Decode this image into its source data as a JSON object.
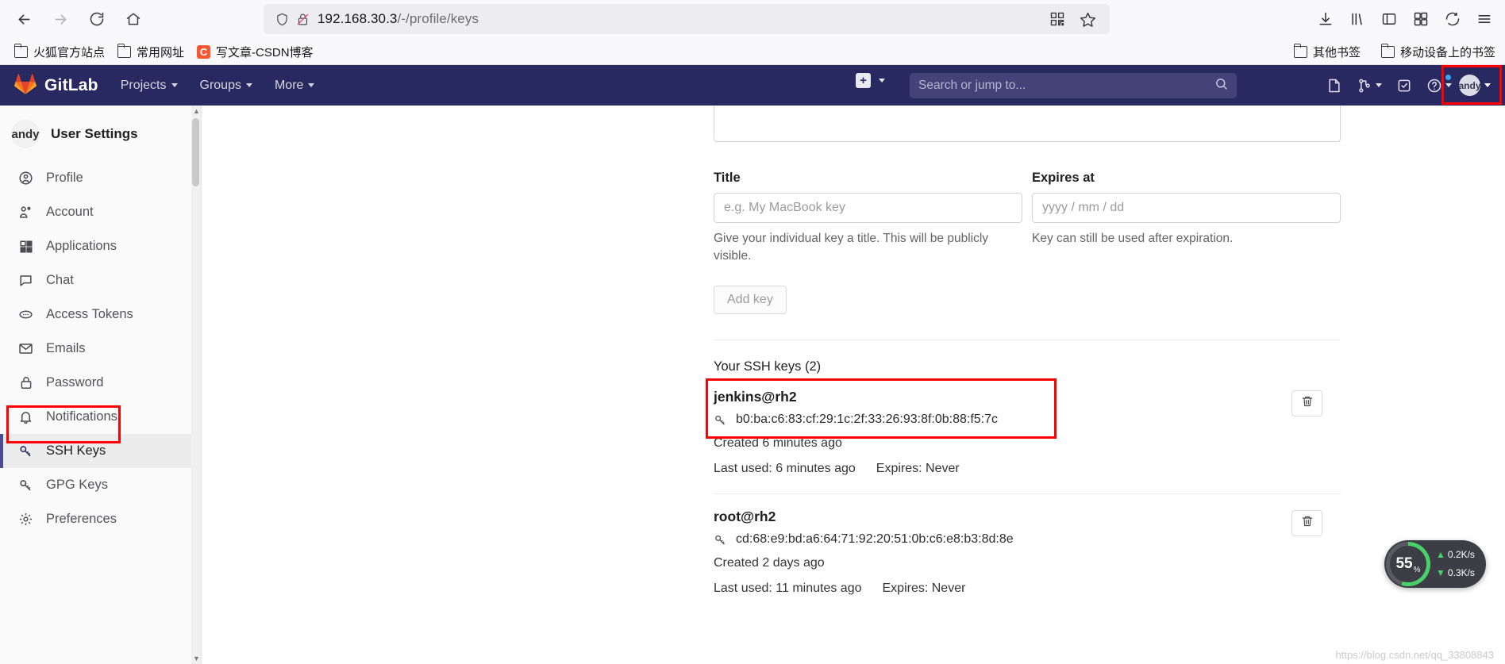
{
  "browser": {
    "back_icon": "back-arrow-icon",
    "forward_icon": "forward-arrow-icon",
    "reload_icon": "reload-icon",
    "home_icon": "home-icon",
    "url_host": "192.168.30.3",
    "url_path": "/-/profile/keys",
    "shield_icon": "tracking-protection-shield-icon",
    "insecure_icon": "insecure-lock-icon",
    "qr_icon": "qr-code-icon",
    "bookmark_star_icon": "bookmark-star-icon",
    "toolbar_icons": [
      "downloads-icon",
      "library-icon",
      "sidebar-icon",
      "extensions-icon",
      "sync-icon",
      "menu-icon"
    ],
    "bookmarks": [
      {
        "label": "火狐官方站点",
        "icon": "folder-icon"
      },
      {
        "label": "常用网址",
        "icon": "folder-icon"
      },
      {
        "label": "写文章-CSDN博客",
        "icon": "csdn-icon"
      }
    ],
    "bookmarks_right": [
      {
        "label": "其他书签",
        "icon": "folder-icon"
      },
      {
        "label": "移动设备上的书签",
        "icon": "folder-icon"
      }
    ]
  },
  "gitlab_nav": {
    "brand": "GitLab",
    "logo_icon": "gitlab-tanuki-icon",
    "items": [
      {
        "label": "Projects",
        "caret": true
      },
      {
        "label": "Groups",
        "caret": true
      },
      {
        "label": "More",
        "caret": true
      }
    ],
    "plus_icon": "plus-square-icon",
    "plus_caret": true,
    "search_placeholder": "Search or jump to...",
    "search_icon": "search-icon",
    "right_icons": [
      {
        "name": "issues-icon"
      },
      {
        "name": "merge-requests-icon",
        "caret": true
      },
      {
        "name": "todos-icon"
      },
      {
        "name": "help-icon",
        "caret": true,
        "dot": true
      }
    ],
    "user": {
      "name": "andy",
      "avatar_initial": "andy",
      "caret": true
    }
  },
  "sidebar": {
    "user_name": "andy",
    "title": "User Settings",
    "items": [
      {
        "label": "Profile",
        "icon": "user-circle-icon",
        "active": false
      },
      {
        "label": "Account",
        "icon": "account-key-icon",
        "active": false
      },
      {
        "label": "Applications",
        "icon": "applications-grid-icon",
        "active": false
      },
      {
        "label": "Chat",
        "icon": "chat-bubble-icon",
        "active": false
      },
      {
        "label": "Access Tokens",
        "icon": "token-icon",
        "active": false
      },
      {
        "label": "Emails",
        "icon": "envelope-icon",
        "active": false
      },
      {
        "label": "Password",
        "icon": "lock-icon",
        "active": false
      },
      {
        "label": "Notifications",
        "icon": "bell-icon",
        "active": false
      },
      {
        "label": "SSH Keys",
        "icon": "key-icon",
        "active": true
      },
      {
        "label": "GPG Keys",
        "icon": "key-icon",
        "active": false
      },
      {
        "label": "Preferences",
        "icon": "settings-icon",
        "active": false
      }
    ]
  },
  "main": {
    "form": {
      "title_label": "Title",
      "title_placeholder": "e.g. My MacBook key",
      "title_help": "Give your individual key a title. This will be publicly visible.",
      "expires_label": "Expires at",
      "expires_placeholder": "yyyy / mm / dd",
      "expires_help": "Key can still be used after expiration.",
      "add_key_label": "Add key"
    },
    "keys_heading": "Your SSH keys (2)",
    "keys": [
      {
        "name": "jenkins@rh2",
        "fingerprint": "b0:ba:c6:83:cf:29:1c:2f:33:26:93:8f:0b:88:f5:7c",
        "created": "Created 6 minutes ago",
        "last_used": "Last used: 6 minutes ago",
        "expires": "Expires: Never",
        "highlighted": true,
        "delete_icon": "trash-icon"
      },
      {
        "name": "root@rh2",
        "fingerprint": "cd:68:e9:bd:a6:64:71:92:20:51:0b:c6:e8:b3:8d:8e",
        "created": "Created 2 days ago",
        "last_used": "Last used: 11 minutes ago",
        "expires": "Expires: Never",
        "highlighted": false,
        "delete_icon": "trash-icon"
      }
    ]
  },
  "netspeed": {
    "percent": "55",
    "percent_symbol": "%",
    "upload": "0.2K/s",
    "download": "0.3K/s",
    "up_arrow": "▲",
    "down_arrow": "▼"
  },
  "watermark": "https://blog.csdn.net/qq_33808843",
  "colors": {
    "gitlab_navy": "#292961",
    "highlight_red": "#fe0000",
    "accent_green": "#49d06a",
    "csdn_orange": "#fc5531"
  }
}
